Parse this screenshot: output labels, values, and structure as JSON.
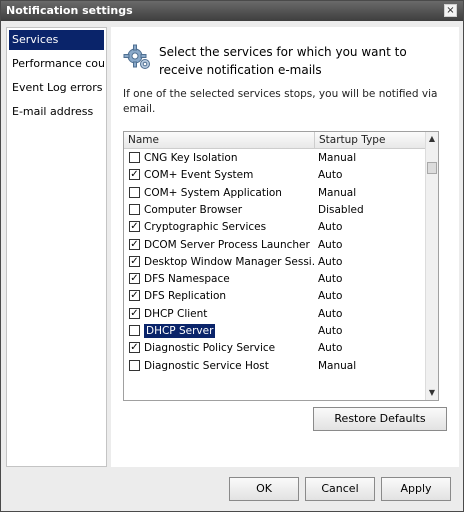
{
  "window": {
    "title": "Notification settings",
    "close_glyph": "×"
  },
  "sidebar": {
    "items": [
      {
        "label": "Services",
        "selected": true
      },
      {
        "label": "Performance cou..."
      },
      {
        "label": "Event Log errors"
      },
      {
        "label": "E-mail address"
      }
    ]
  },
  "main": {
    "heading": "Select the services for which you want to receive notification e-mails",
    "subtext": "If one of the selected services stops, you will be notified via email.",
    "icon": "gear-icon",
    "list": {
      "columns": {
        "name": "Name",
        "startup_type": "Startup Type"
      },
      "rows": [
        {
          "name": "CNG Key Isolation",
          "type": "Manual",
          "checked": false
        },
        {
          "name": "COM+ Event System",
          "type": "Auto",
          "checked": true
        },
        {
          "name": "COM+ System Application",
          "type": "Manual",
          "checked": false
        },
        {
          "name": "Computer Browser",
          "type": "Disabled",
          "checked": false
        },
        {
          "name": "Cryptographic Services",
          "type": "Auto",
          "checked": true
        },
        {
          "name": "DCOM Server Process Launcher",
          "type": "Auto",
          "checked": true
        },
        {
          "name": "Desktop Window Manager Sessi...",
          "type": "Auto",
          "checked": true
        },
        {
          "name": "DFS Namespace",
          "type": "Auto",
          "checked": true
        },
        {
          "name": "DFS Replication",
          "type": "Auto",
          "checked": true
        },
        {
          "name": "DHCP Client",
          "type": "Auto",
          "checked": true
        },
        {
          "name": "DHCP Server",
          "type": "Auto",
          "checked": false,
          "selected": true
        },
        {
          "name": "Diagnostic Policy Service",
          "type": "Auto",
          "checked": true
        },
        {
          "name": "Diagnostic Service Host",
          "type": "Manual",
          "checked": false
        }
      ]
    },
    "restore_label": "Restore Defaults"
  },
  "footer": {
    "ok_label": "OK",
    "cancel_label": "Cancel",
    "apply_label": "Apply"
  },
  "colors": {
    "selection": "#0a246a",
    "titlebar": "#4a4a4a"
  }
}
